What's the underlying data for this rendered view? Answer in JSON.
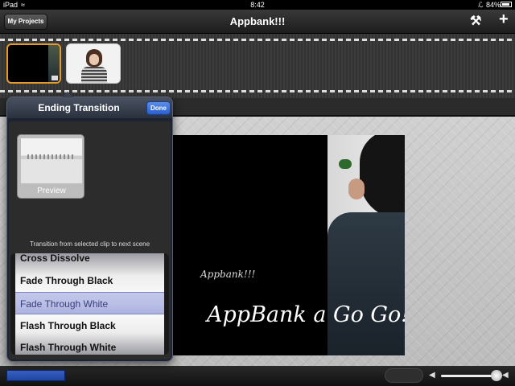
{
  "status_bar": {
    "carrier": "iPad",
    "time": "8:42",
    "battery_percent": "84%"
  },
  "nav": {
    "title": "Appbank!!!",
    "back_label": "My Projects"
  },
  "popover": {
    "title": "Ending Transition",
    "done_label": "Done",
    "preview_label": "Preview",
    "hint": "Transition from selected clip to next scene",
    "options": [
      "Cross Dissolve",
      "Fade Through Black",
      "Fade Through White",
      "Flash Through Black",
      "Flash Through White"
    ],
    "selected_option": "Fade Through White"
  },
  "video": {
    "overlay_small": "Appbank!!!",
    "overlay_title": "AppBank a Go Go!"
  },
  "icons": {
    "wifi": "wifi-icon",
    "bluetooth": "bluetooth-icon",
    "battery": "battery-icon",
    "settings": "wrench-icon",
    "add": "plus-icon",
    "volume_low": "volume-low-icon",
    "volume_high": "volume-high-icon"
  },
  "colors": {
    "accent_blue": "#2a5fd0",
    "clip_selected_border": "#e69a2a"
  }
}
